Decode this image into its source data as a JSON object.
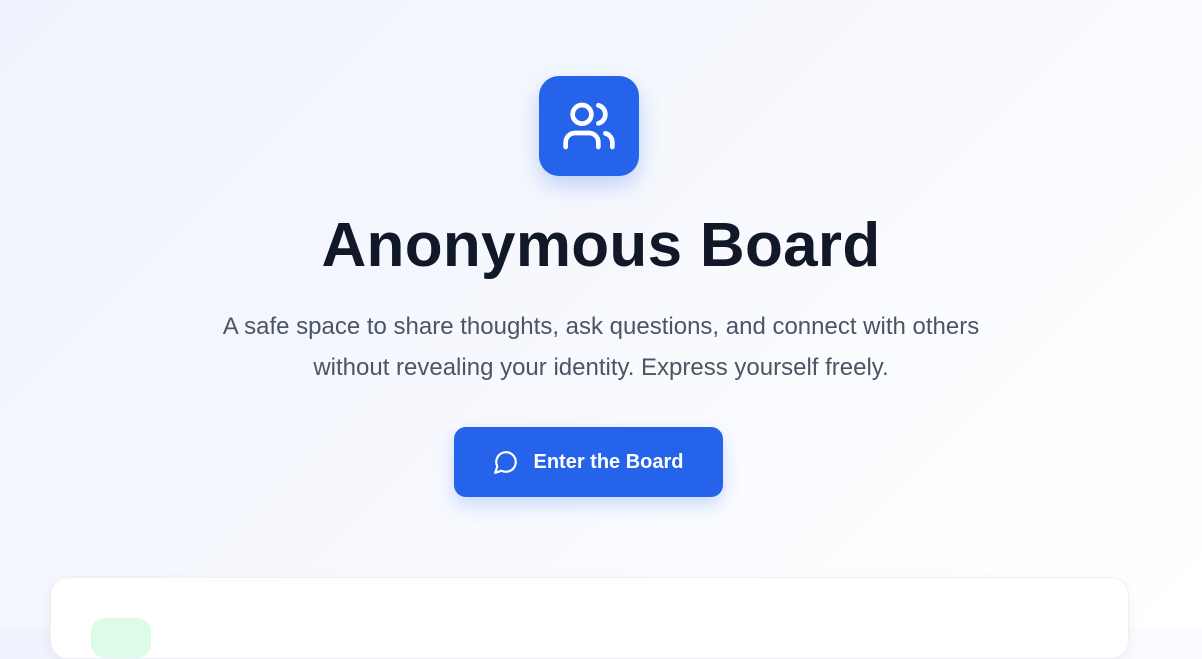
{
  "hero": {
    "logo_icon": "users-icon",
    "title": "Anonymous Board",
    "subtitle": "A safe space to share thoughts, ask questions, and connect with others without revealing your identity. Express yourself freely.",
    "cta": {
      "label": "Enter the Board",
      "icon": "message-circle-icon"
    }
  },
  "colors": {
    "accent": "#2563eb",
    "title": "#111827",
    "subtitle": "#4b5563",
    "badge": "#dcfce7"
  }
}
